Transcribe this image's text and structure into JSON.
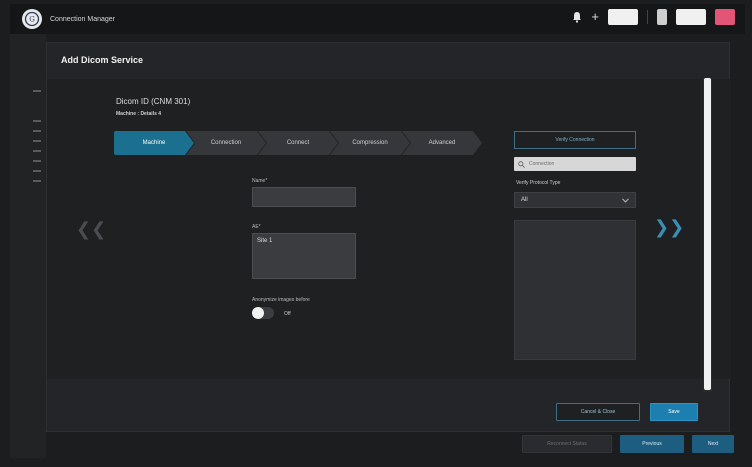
{
  "app": {
    "title": "Connection Manager"
  },
  "modal": {
    "title": "Add Dicom Service",
    "service_name": "Dicom ID (CNM 301)",
    "service_sub": "Machine : Details 4"
  },
  "steps": [
    {
      "label": "Machine",
      "active": true
    },
    {
      "label": "Connection",
      "active": false
    },
    {
      "label": "Connect",
      "active": false
    },
    {
      "label": "Compression",
      "active": false
    },
    {
      "label": "Advanced",
      "active": false
    }
  ],
  "form": {
    "field1_label": "Name*",
    "field1_value": "",
    "field2_label": "AE*",
    "field2_value": "Site 1",
    "toggle_label": "Anonymize images before",
    "toggle_text": "Off"
  },
  "panel": {
    "button_label": "Verify Connection",
    "search_placeholder": "Connection",
    "select_label": "Verify Protocol Type",
    "select_value": "All"
  },
  "footer": {
    "modal_secondary": "Cancel & Close",
    "modal_primary": "Save",
    "bottom_disabled": "Reconnect Status",
    "bottom_secondary": "Previous",
    "bottom_primary": "Next"
  },
  "colors": {
    "accent": "#1b6f8f",
    "primary": "#1d7fb0",
    "pink": "#e35577"
  },
  "icons": [
    "ge-logo-icon",
    "bell-icon",
    "plus-icon",
    "search-icon",
    "chevron-down-icon",
    "chevron-left-icon",
    "chevron-right-icon"
  ]
}
